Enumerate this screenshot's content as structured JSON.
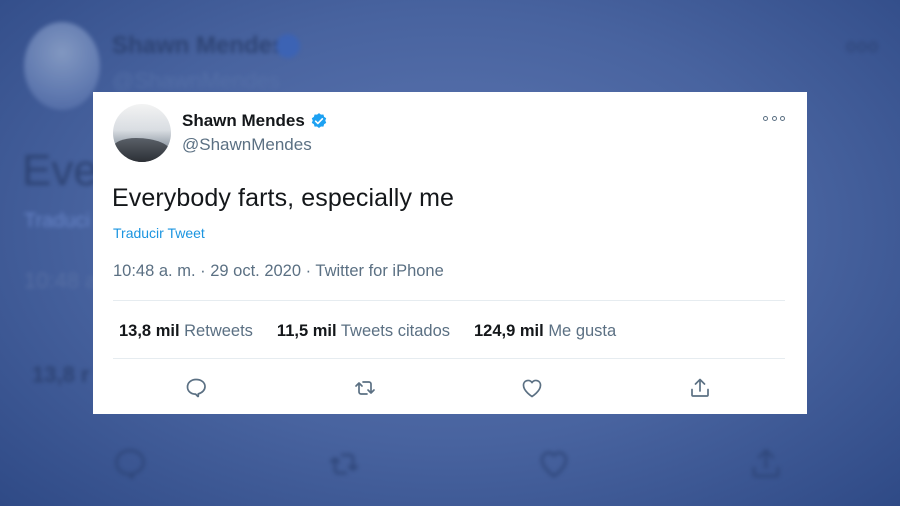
{
  "background": {
    "name": "Shawn Mendes",
    "handle": "@ShawnMendes",
    "text_fragment": "Ever",
    "translate_fragment": "Traduci",
    "time_fragment": "10:48 a",
    "count_fragment": "13,8 r",
    "more_label": "ooo"
  },
  "tweet": {
    "author_name": "Shawn Mendes",
    "author_handle": "@ShawnMendes",
    "verified": true,
    "text": "Everybody farts, especially me",
    "translate_link": "Traducir Tweet",
    "timestamp": "10:48 a. m. · 29 oct. 2020 · Twitter for iPhone",
    "stats": {
      "retweets_count": "13,8 mil",
      "retweets_label": "Retweets",
      "quotes_count": "11,5 mil",
      "quotes_label": "Tweets citados",
      "likes_count": "124,9 mil",
      "likes_label": "Me gusta"
    },
    "actions": [
      "reply-icon",
      "retweet-icon",
      "like-icon",
      "share-icon"
    ]
  },
  "colors": {
    "accent": "#1b95e0",
    "verified": "#1da1f2",
    "text_primary": "#14171a",
    "text_secondary": "#5b7083",
    "background_blue": "#3f5b9c"
  }
}
